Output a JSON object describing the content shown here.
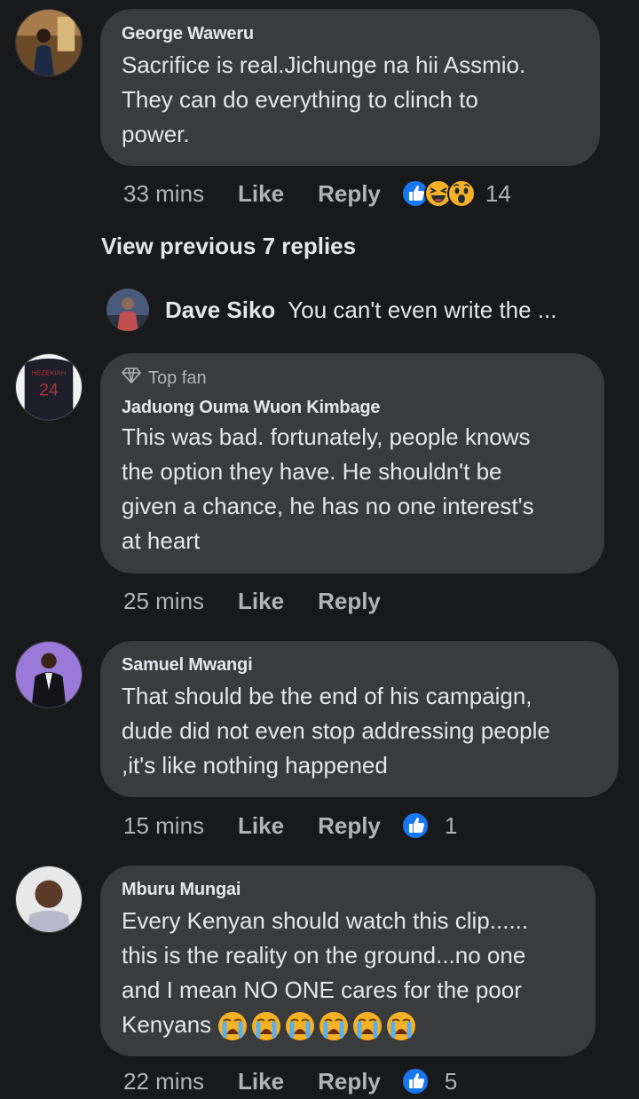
{
  "comments": [
    {
      "name": "George Waweru",
      "text": "Sacrifice is real.Jichunge na hii Assmio.\nThey can do everything to clinch to\npower.",
      "time": "33 mins",
      "like": "Like",
      "reply": "Reply",
      "reactions": [
        "like-icon",
        "haha-icon",
        "wow-icon"
      ],
      "reaction_count": "14"
    },
    {
      "badge": "Top fan",
      "name": "Jaduong Ouma Wuon Kimbage",
      "text": "This was bad. fortunately, people knows\nthe option they have. He shouldn't be\ngiven a chance, he has no one interest's\nat heart",
      "time": "25 mins",
      "like": "Like",
      "reply": "Reply"
    },
    {
      "name": "Samuel Mwangi",
      "text": "That should be the end of his campaign,\ndude did not even stop addressing people\n,it's like nothing happened",
      "time": "15 mins",
      "like": "Like",
      "reply": "Reply",
      "reactions": [
        "like-icon"
      ],
      "reaction_count": "1"
    },
    {
      "name": "Mburu Mungai",
      "text": "Every Kenyan should watch this clip......\nthis is the reality on the ground...no one\nand I mean NO ONE cares for the poor\nKenyans",
      "emoji_count": 6,
      "emoji_name": "loudly-crying-face-icon",
      "time": "22 mins",
      "like": "Like",
      "reply": "Reply",
      "reactions": [
        "like-icon"
      ],
      "reaction_count": "5"
    }
  ],
  "view_previous": "View previous 7 replies",
  "reply_preview": {
    "name": "Dave Siko",
    "text": "You can't even write the ..."
  },
  "colors": {
    "background": "#18191a",
    "bubble": "#3a3b3c",
    "text": "#e4e6eb",
    "secondary": "#b0b3b8",
    "like_blue": "#1877f2",
    "emoji_yellow": "#f7b125"
  }
}
